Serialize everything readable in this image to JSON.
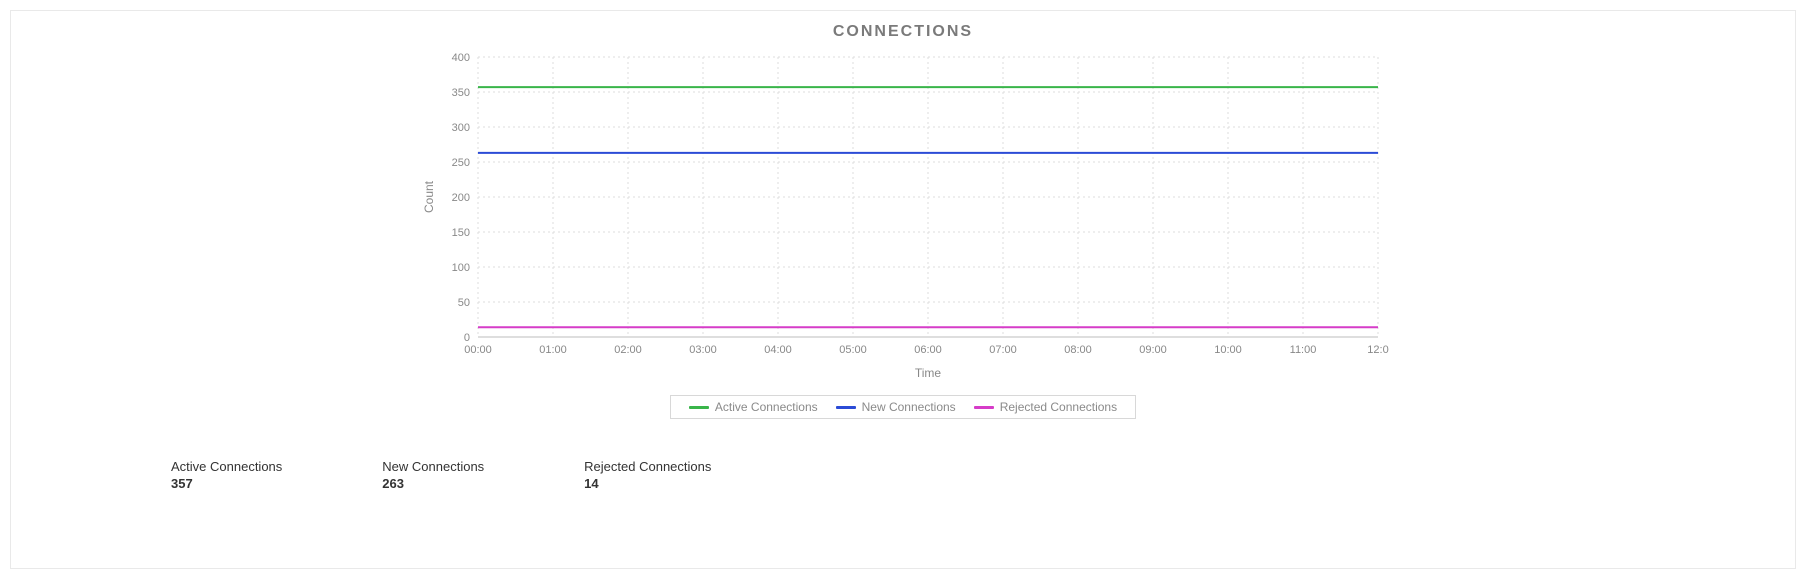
{
  "title": "CONNECTIONS",
  "xlabel": "Time",
  "ylabel": "Count",
  "legend": {
    "active": "Active Connections",
    "new": "New Connections",
    "rejected": "Rejected Connections"
  },
  "colors": {
    "active": "#39b54a",
    "new": "#2b4bd6",
    "rejected": "#d63cc8"
  },
  "stats": {
    "active": {
      "label": "Active Connections",
      "value": "357"
    },
    "new": {
      "label": "New Connections",
      "value": "263"
    },
    "rejected": {
      "label": "Rejected Connections",
      "value": "14"
    }
  },
  "chart_data": {
    "type": "line",
    "title": "CONNECTIONS",
    "xlabel": "Time",
    "ylabel": "Count",
    "x_ticks": [
      "00:00",
      "01:00",
      "02:00",
      "03:00",
      "04:00",
      "05:00",
      "06:00",
      "07:00",
      "08:00",
      "09:00",
      "10:00",
      "11:00",
      "12:0"
    ],
    "y_ticks": [
      0,
      50,
      100,
      150,
      200,
      250,
      300,
      350,
      400
    ],
    "ylim": [
      0,
      400
    ],
    "categories": [
      "00:00",
      "01:00",
      "02:00",
      "03:00",
      "04:00",
      "05:00",
      "06:00",
      "07:00",
      "08:00",
      "09:00",
      "10:00",
      "11:00",
      "12:0"
    ],
    "series": [
      {
        "name": "Active Connections",
        "color": "#39b54a",
        "values": [
          357,
          357,
          357,
          357,
          357,
          357,
          357,
          357,
          357,
          357,
          357,
          357,
          357
        ]
      },
      {
        "name": "New Connections",
        "color": "#2b4bd6",
        "values": [
          263,
          263,
          263,
          263,
          263,
          263,
          263,
          263,
          263,
          263,
          263,
          263,
          263
        ]
      },
      {
        "name": "Rejected Connections",
        "color": "#d63cc8",
        "values": [
          14,
          14,
          14,
          14,
          14,
          14,
          14,
          14,
          14,
          14,
          14,
          14,
          14
        ]
      }
    ]
  }
}
